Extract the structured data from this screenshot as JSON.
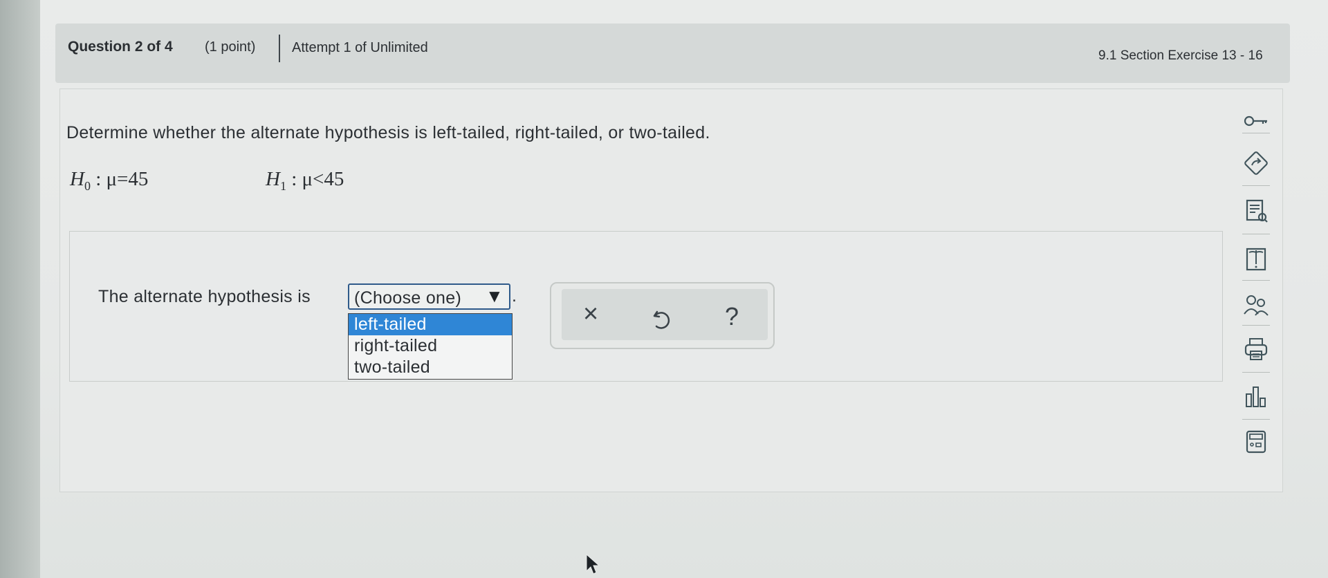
{
  "header": {
    "question_label": "Question 2 of 4",
    "points": "(1 point)",
    "attempt": "Attempt 1 of Unlimited",
    "section": "9.1 Section Exercise 13 - 16"
  },
  "question": {
    "prompt": "Determine whether the alternate hypothesis is left-tailed, right-tailed, or two-tailed.",
    "h0": {
      "var": "H",
      "sub": "0",
      "rel": " : μ=45"
    },
    "h1": {
      "var": "H",
      "sub": "1",
      "rel": " : μ<45"
    }
  },
  "answer": {
    "label": "The alternate hypothesis is",
    "select_value": "(Choose one)",
    "arrow": "▼",
    "period": ".",
    "options": [
      "left-tailed",
      "right-tailed",
      "two-tailed"
    ],
    "highlighted_option": "left-tailed"
  },
  "actions": {
    "clear": "×",
    "undo": "↺",
    "help": "?"
  },
  "sidebar_tools": [
    "key-icon",
    "diamond-arrow-icon",
    "document-search-icon",
    "book-icon",
    "people-help-icon",
    "print-icon",
    "bar-chart-icon",
    "calculator-icon"
  ],
  "colors": {
    "selected_option_bg": "#2f86d6",
    "select_border": "#2e5a8a"
  }
}
